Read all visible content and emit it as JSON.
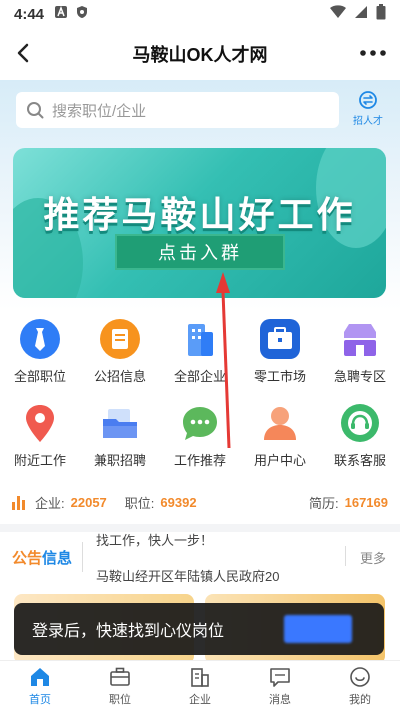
{
  "status_bar": {
    "time": "4:44"
  },
  "nav": {
    "title": "马鞍山OK人才网"
  },
  "search": {
    "placeholder": "搜索职位/企业",
    "recruit_label": "招人才"
  },
  "banner": {
    "headline": "推荐马鞍山好工作",
    "button": "点击入群"
  },
  "grid": {
    "items": [
      {
        "label": "全部职位",
        "icon": "tie-icon",
        "color": "#2f7df6"
      },
      {
        "label": "公招信息",
        "icon": "document-icon",
        "color": "#f7931e"
      },
      {
        "label": "全部企业",
        "icon": "building-icon",
        "color": "#3e8ef7"
      },
      {
        "label": "零工市场",
        "icon": "briefcase-icon",
        "color": "#1f64d8"
      },
      {
        "label": "急聘专区",
        "icon": "store-icon",
        "color": "#8e63e8"
      },
      {
        "label": "附近工作",
        "icon": "location-pin-icon",
        "color": "#f05a4f"
      },
      {
        "label": "兼职招聘",
        "icon": "folder-icon",
        "color": "#4a7df0"
      },
      {
        "label": "工作推荐",
        "icon": "chat-bubble-icon",
        "color": "#5cb85c"
      },
      {
        "label": "用户中心",
        "icon": "user-icon",
        "color": "#f5875a"
      },
      {
        "label": "联系客服",
        "icon": "customer-service-icon",
        "color": "#3cb96b"
      }
    ]
  },
  "stats": {
    "companies_label": "企业:",
    "companies_value": "22057",
    "jobs_label": "职位:",
    "jobs_value": "69392",
    "resumes_label": "简历:",
    "resumes_value": "167169"
  },
  "notice": {
    "tag_a": "公告",
    "tag_b": "信息",
    "line1": "找工作，快人一步！",
    "line2": "马鞍山经开区年陆镇人民政府20",
    "more": "更多"
  },
  "toast": {
    "text": "登录后，快速找到心仪岗位"
  },
  "tabbar": {
    "items": [
      {
        "label": "首页",
        "icon": "home-icon",
        "active": true
      },
      {
        "label": "职位",
        "icon": "briefcase-icon",
        "active": false
      },
      {
        "label": "企业",
        "icon": "building-icon",
        "active": false
      },
      {
        "label": "消息",
        "icon": "message-icon",
        "active": false
      },
      {
        "label": "我的",
        "icon": "smiley-icon",
        "active": false
      }
    ]
  },
  "colors": {
    "accent": "#1e88e5",
    "number": "#f28a2c",
    "annotation_arrow": "#e53935"
  }
}
